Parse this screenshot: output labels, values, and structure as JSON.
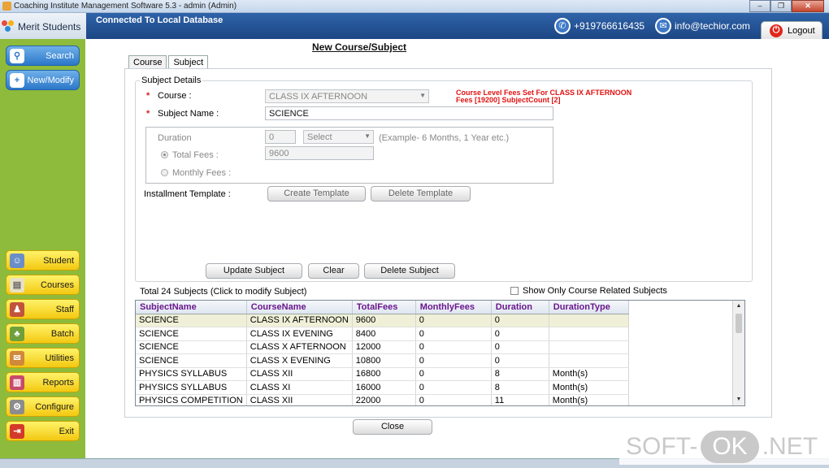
{
  "window": {
    "title": "Coaching Institute Management Software 5.3  -  admin (Admin)",
    "controls": {
      "minimize": "–",
      "restore": "❐",
      "close": "✕"
    }
  },
  "header": {
    "brand": "Merit Students",
    "connection": "Connected To  Local Database",
    "phone": "+919766616435",
    "email": "info@techior.com",
    "logout": "Logout"
  },
  "sidebar": {
    "top": [
      {
        "label": "Search",
        "icon": "search-icon",
        "glyph": "⚲"
      },
      {
        "label": "New/Modify",
        "icon": "add-icon",
        "glyph": "+"
      }
    ],
    "items": [
      {
        "label": "Student",
        "icon": "student-icon",
        "glyph": "☺",
        "color": "#6a8ec8"
      },
      {
        "label": "Courses",
        "icon": "courses-icon",
        "glyph": "▤",
        "color": "#e9e1c4"
      },
      {
        "label": "Staff",
        "icon": "staff-icon",
        "glyph": "♟",
        "color": "#c2533b"
      },
      {
        "label": "Batch",
        "icon": "batch-icon",
        "glyph": "♣",
        "color": "#6fa03a"
      },
      {
        "label": "Utilities",
        "icon": "utilities-icon",
        "glyph": "✉",
        "color": "#d0883a"
      },
      {
        "label": "Reports",
        "icon": "reports-icon",
        "glyph": "▥",
        "color": "#c84a6a"
      },
      {
        "label": "Configure",
        "icon": "configure-icon",
        "glyph": "⚙",
        "color": "#8c8c8c"
      },
      {
        "label": "Exit",
        "icon": "exit-icon",
        "glyph": "⇥",
        "color": "#d33a2a"
      }
    ]
  },
  "page": {
    "title": "New Course/Subject",
    "tabs": [
      "Course",
      "Subject"
    ],
    "active_tab": "Subject"
  },
  "form": {
    "group_title": "Subject Details",
    "course_label": "Course :",
    "course_value": "CLASS IX AFTERNOON",
    "subject_name_label": "Subject Name :",
    "subject_name_value": "SCIENCE",
    "warning_line1": "Course Level Fees Set For CLASS IX AFTERNOON",
    "warning_line2": "Fees [19200]  SubjectCount [2]",
    "duration_label": "Duration",
    "duration_value": "0",
    "duration_unit": "Select",
    "duration_hint": "(Example- 6 Months, 1 Year etc.)",
    "total_fees_label": "Total Fees :",
    "total_fees_value": "9600",
    "monthly_fees_label": "Monthly Fees :",
    "installment_label": "Installment Template :",
    "create_template": "Create Template",
    "delete_template": "Delete Template",
    "update_subject": "Update Subject",
    "clear": "Clear",
    "delete_subject": "Delete Subject"
  },
  "list": {
    "total_label": "Total 24 Subjects (Click to modify Subject)",
    "filter_label": "Show Only Course Related Subjects",
    "columns": [
      "SubjectName",
      "CourseName",
      "TotalFees",
      "MonthlyFees",
      "Duration",
      "DurationType"
    ],
    "rows": [
      [
        "SCIENCE",
        "CLASS IX AFTERNOON",
        "9600",
        "0",
        "0",
        ""
      ],
      [
        "SCIENCE",
        "CLASS IX EVENING",
        "8400",
        "0",
        "0",
        ""
      ],
      [
        "SCIENCE",
        "CLASS X AFTERNOON",
        "12000",
        "0",
        "0",
        ""
      ],
      [
        "SCIENCE",
        "CLASS X EVENING",
        "10800",
        "0",
        "0",
        ""
      ],
      [
        "PHYSICS SYLLABUS",
        "CLASS XII",
        "16800",
        "0",
        "8",
        "Month(s)"
      ],
      [
        "PHYSICS SYLLABUS",
        "CLASS XI",
        "16000",
        "0",
        "8",
        "Month(s)"
      ],
      [
        "PHYSICS COMPETITION",
        "CLASS XII",
        "22000",
        "0",
        "11",
        "Month(s)"
      ]
    ],
    "selected_row": 0
  },
  "footer": {
    "close": "Close"
  },
  "watermark": {
    "left": "SOFT-",
    "ok": "OK",
    "right": ".NET"
  },
  "colors": {
    "sidebar": "#8ebb3b",
    "header": "#2f63a9",
    "warning": "#e21111",
    "column_header": "#6a178d"
  }
}
